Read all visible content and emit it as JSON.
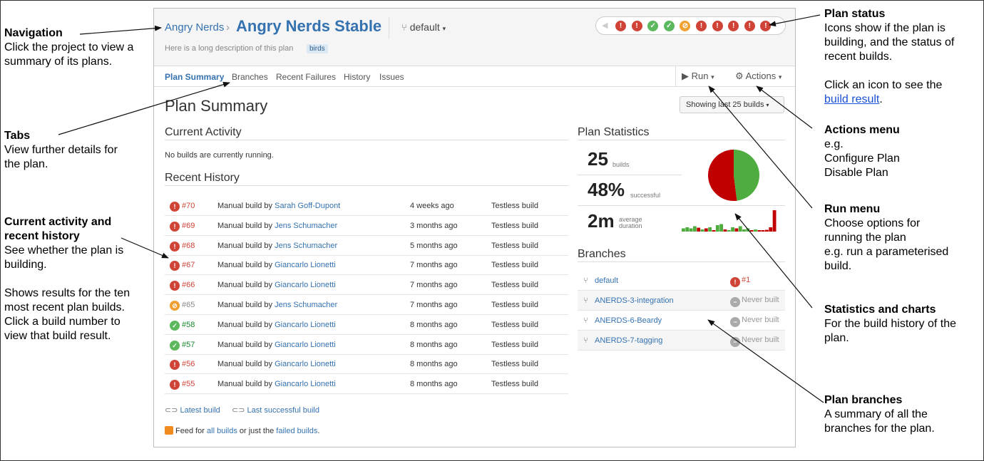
{
  "annotations": {
    "navigation": {
      "title": "Navigation",
      "body": "Click the project to view a summary of its plans."
    },
    "tabs": {
      "title": "Tabs",
      "body": "View further details for the plan."
    },
    "current_activity": {
      "title1": "Current activity and",
      "title2": "recent history",
      "body": "See whether the plan is building.",
      "body2": "Shows results for the ten most recent plan builds. Click a build number to view that build result."
    },
    "plan_status": {
      "title": "Plan status",
      "body": "Icons show if the plan is building, and the status of recent builds.",
      "body2_pre": "Click an icon to see the",
      "body2_link": "build result",
      "body2_post": "."
    },
    "actions_menu": {
      "title": "Actions menu",
      "line1": "e.g.",
      "line2": "Configure Plan",
      "line3": "Disable Plan"
    },
    "run_menu": {
      "title": "Run menu",
      "body": "Choose options for running the plan",
      "body2": "e.g. run a parameterised build."
    },
    "statistics": {
      "title": "Statistics and charts",
      "body": "For the build history of the plan."
    },
    "plan_branches": {
      "title": "Plan branches",
      "body": "A summary of all the branches for the plan."
    }
  },
  "header": {
    "project": "Angry Nerds",
    "separator": "›",
    "plan": "Angry Nerds Stable",
    "branch_selector": "default",
    "description": "Here is a long description of this plan",
    "label": "birds",
    "status_icons": [
      "fail",
      "fail",
      "ok",
      "ok",
      "warn",
      "fail",
      "fail",
      "fail",
      "fail",
      "fail"
    ]
  },
  "tabs": [
    "Plan Summary",
    "Branches",
    "Recent Failures",
    "History",
    "Issues"
  ],
  "menus": {
    "run": "Run",
    "actions": "Actions"
  },
  "page_title": "Plan Summary",
  "showing": "Showing last 25 builds",
  "current_activity": {
    "heading": "Current Activity",
    "text": "No builds are currently running."
  },
  "recent_history": {
    "heading": "Recent History",
    "rows": [
      {
        "status": "fail",
        "number": "#70",
        "trigger": "Manual build by",
        "user": "Sarah Goff-Dupont",
        "when": "4 weeks ago",
        "tests": "Testless build"
      },
      {
        "status": "fail",
        "number": "#69",
        "trigger": "Manual build by",
        "user": "Jens Schumacher",
        "when": "3 months ago",
        "tests": "Testless build"
      },
      {
        "status": "fail",
        "number": "#68",
        "trigger": "Manual build by",
        "user": "Jens Schumacher",
        "when": "5 months ago",
        "tests": "Testless build"
      },
      {
        "status": "fail",
        "number": "#67",
        "trigger": "Manual build by",
        "user": "Giancarlo Lionetti",
        "when": "7 months ago",
        "tests": "Testless build"
      },
      {
        "status": "fail",
        "number": "#66",
        "trigger": "Manual build by",
        "user": "Giancarlo Lionetti",
        "when": "7 months ago",
        "tests": "Testless build"
      },
      {
        "status": "warn",
        "number": "#65",
        "trigger": "Manual build by",
        "user": "Jens Schumacher",
        "when": "7 months ago",
        "tests": "Testless build"
      },
      {
        "status": "ok",
        "number": "#58",
        "trigger": "Manual build by",
        "user": "Giancarlo Lionetti",
        "when": "8 months ago",
        "tests": "Testless build"
      },
      {
        "status": "ok",
        "number": "#57",
        "trigger": "Manual build by",
        "user": "Giancarlo Lionetti",
        "when": "8 months ago",
        "tests": "Testless build"
      },
      {
        "status": "fail",
        "number": "#56",
        "trigger": "Manual build by",
        "user": "Giancarlo Lionetti",
        "when": "8 months ago",
        "tests": "Testless build"
      },
      {
        "status": "fail",
        "number": "#55",
        "trigger": "Manual build by",
        "user": "Giancarlo Lionetti",
        "when": "8 months ago",
        "tests": "Testless build"
      }
    ]
  },
  "footer": {
    "latest": "Latest build",
    "last_successful": "Last successful build",
    "feed_pre": "Feed for",
    "feed_all": "all builds",
    "feed_mid": "or just the",
    "feed_failed": "failed builds",
    "feed_post": "."
  },
  "statistics": {
    "heading": "Plan Statistics",
    "builds": "25",
    "builds_label": "builds",
    "success_rate": "48%",
    "success_label": "successful",
    "duration": "2m",
    "duration_label1": "average",
    "duration_label2": "duration",
    "pie_success_fraction": 0.48,
    "duration_bars": [
      {
        "s": "ok",
        "v": 0.15
      },
      {
        "s": "ok",
        "v": 0.2
      },
      {
        "s": "ok",
        "v": 0.15
      },
      {
        "s": "ok",
        "v": 0.25
      },
      {
        "s": "fail",
        "v": 0.18
      },
      {
        "s": "ok",
        "v": 0.1
      },
      {
        "s": "fail",
        "v": 0.15
      },
      {
        "s": "ok",
        "v": 0.2
      },
      {
        "s": "fail",
        "v": 0.05
      },
      {
        "s": "ok",
        "v": 0.3
      },
      {
        "s": "ok",
        "v": 0.35
      },
      {
        "s": "fail",
        "v": 0.1
      },
      {
        "s": "ok",
        "v": 0.05
      },
      {
        "s": "ok",
        "v": 0.2
      },
      {
        "s": "fail",
        "v": 0.15
      },
      {
        "s": "ok",
        "v": 0.25
      },
      {
        "s": "ok",
        "v": 0.1
      },
      {
        "s": "ok",
        "v": 0.15
      },
      {
        "s": "fail",
        "v": 0.05
      },
      {
        "s": "ok",
        "v": 0.1
      },
      {
        "s": "fail",
        "v": 0.05
      },
      {
        "s": "fail",
        "v": 0.05
      },
      {
        "s": "fail",
        "v": 0.08
      },
      {
        "s": "fail",
        "v": 0.2
      },
      {
        "s": "fail",
        "v": 1.0
      }
    ],
    "colors": {
      "success": "#14892c",
      "fail": "#c00000"
    }
  },
  "branches": {
    "heading": "Branches",
    "rows": [
      {
        "name": "default",
        "status": "#1",
        "kind": "fail"
      },
      {
        "name": "ANERDS-3-integration",
        "status": "Never built",
        "kind": "never"
      },
      {
        "name": "ANERDS-6-Beardy",
        "status": "Never built",
        "kind": "never"
      },
      {
        "name": "ANERDS-7-tagging",
        "status": "Never built",
        "kind": "never"
      }
    ]
  }
}
